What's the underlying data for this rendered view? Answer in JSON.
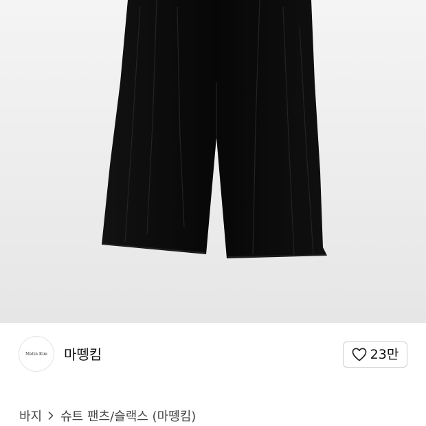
{
  "product": {
    "image": {
      "icon": "black-wide-pleated-pants-photo"
    }
  },
  "brand": {
    "logo_text": "Matin Kim",
    "name": "마뗑킴"
  },
  "likes": {
    "count": "23만",
    "icon": "heart-outline-icon"
  },
  "breadcrumb": {
    "items": [
      "바지",
      "슈트 팬츠/슬랙스 (마뗑킴)"
    ],
    "separator_icon": "chevron-right-icon"
  }
}
